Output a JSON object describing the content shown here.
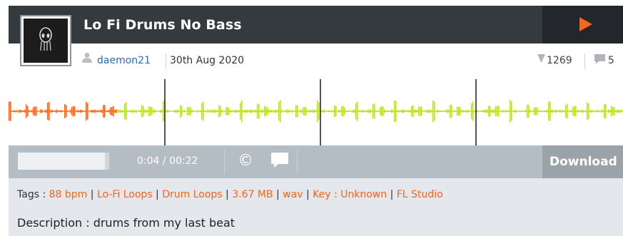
{
  "sample": {
    "title": "Lo Fi Drums No Bass",
    "username": "daemon21",
    "date": "30th Aug 2020",
    "downloads": "1269",
    "comments": "5"
  },
  "player": {
    "time": "0:04 / 00:22",
    "progress": 0.18,
    "download_label": "Download"
  },
  "tags": {
    "label": "Tags : ",
    "items": [
      "88 bpm",
      "Lo-Fi Loops",
      "Drum Loops",
      "3.67 MB",
      "wav",
      "Key : Unknown",
      "FL Studio"
    ],
    "separator": " | "
  },
  "description": {
    "text": "Description : drums from my last beat"
  },
  "icons": {
    "avatar": "alien-head-icon",
    "user": "user-icon",
    "downloads": "down-triangle-icon",
    "comments": "comment-icon",
    "play": "play-icon",
    "copyright": "copyright-icon",
    "chat": "chat-bubble-icon"
  },
  "colors": {
    "accent": "#f2661e",
    "played_wave": "#f2661e",
    "unplayed_wave": "#b5dd2f",
    "titlebar": "#353a3f",
    "controls": "#b4bcc4",
    "link": "#2b6bb3"
  }
}
